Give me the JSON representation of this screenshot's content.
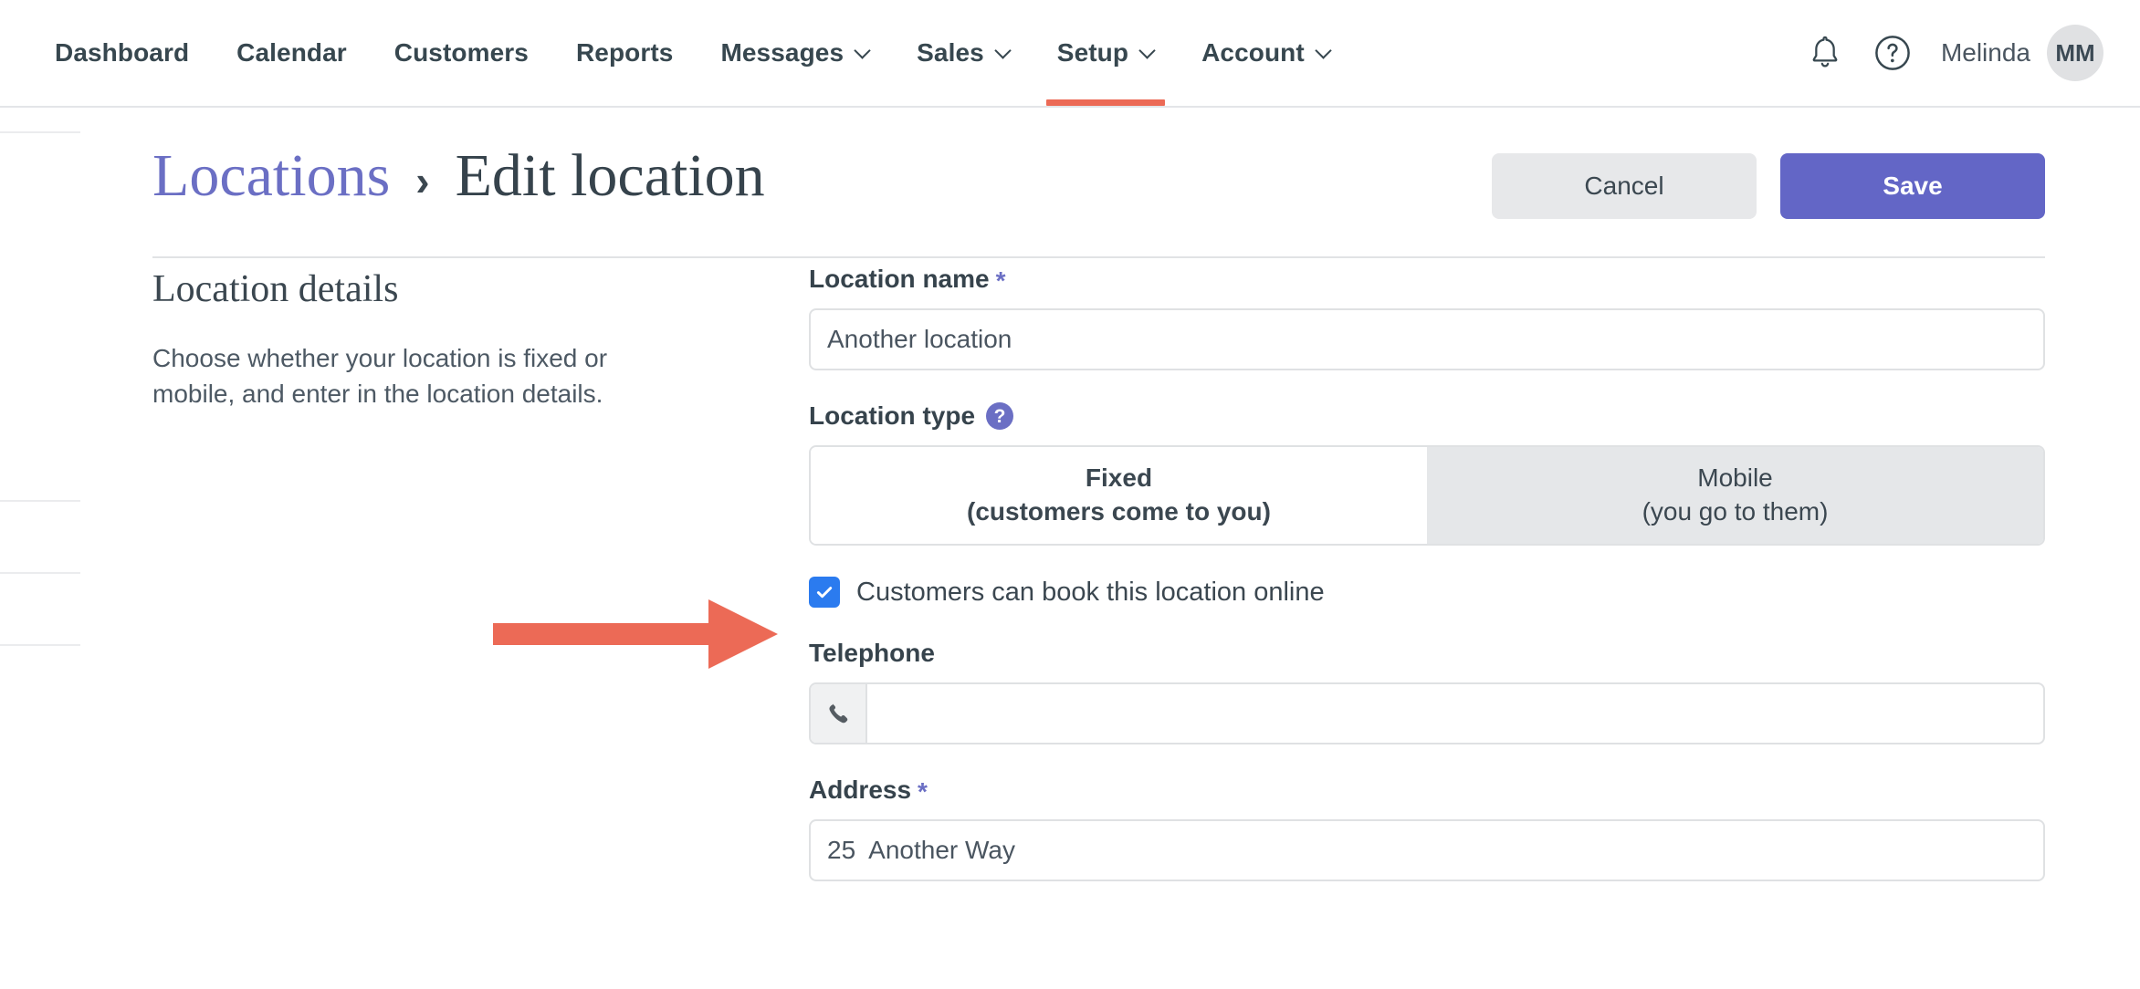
{
  "nav": {
    "items": [
      {
        "label": "Dashboard",
        "has_caret": false,
        "active": false
      },
      {
        "label": "Calendar",
        "has_caret": false,
        "active": false
      },
      {
        "label": "Customers",
        "has_caret": false,
        "active": false
      },
      {
        "label": "Reports",
        "has_caret": false,
        "active": false
      },
      {
        "label": "Messages",
        "has_caret": true,
        "active": false
      },
      {
        "label": "Sales",
        "has_caret": true,
        "active": false
      },
      {
        "label": "Setup",
        "has_caret": true,
        "active": true
      },
      {
        "label": "Account",
        "has_caret": true,
        "active": false
      }
    ],
    "notifications_icon": "bell-icon",
    "help_icon": "question-circle-icon",
    "user_name": "Melinda",
    "avatar_initials": "MM"
  },
  "header": {
    "breadcrumb_link": "Locations",
    "breadcrumb_separator": "›",
    "breadcrumb_current": "Edit location",
    "cancel_label": "Cancel",
    "save_label": "Save"
  },
  "left_panel": {
    "title": "Location details",
    "description": "Choose whether your location is fixed or mobile, and enter in the location details."
  },
  "form": {
    "location_name": {
      "label": "Location name",
      "required_mark": "*",
      "value": "Another location",
      "placeholder": ""
    },
    "location_type": {
      "label": "Location type",
      "help_glyph": "?",
      "options": [
        {
          "line1": "Fixed",
          "line2": "(customers come to you)",
          "selected": true
        },
        {
          "line1": "Mobile",
          "line2": "(you go to them)",
          "selected": false
        }
      ]
    },
    "online_booking": {
      "label": "Customers can book this location online",
      "checked": true
    },
    "telephone": {
      "label": "Telephone",
      "addon_icon": "phone-icon",
      "value": "",
      "placeholder": ""
    },
    "address": {
      "label": "Address",
      "required_mark": "*",
      "value": "25  Another Way",
      "placeholder": ""
    }
  },
  "colors": {
    "brand_purple": "#6366c6",
    "accent_coral": "#ec6a56",
    "checkbox_blue": "#2b7bef",
    "text_dark": "#36434c"
  },
  "annotation": {
    "arrow_color": "#ec6a56",
    "points_to": "online-booking-checkbox"
  }
}
